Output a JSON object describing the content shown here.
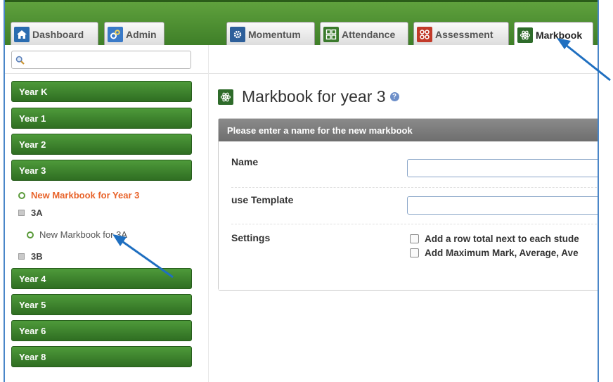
{
  "tabs": [
    {
      "label": "Dashboard",
      "icon": "home-icon",
      "color": "#2a6cb0"
    },
    {
      "label": "Admin",
      "icon": "gears-icon",
      "color": "#3a7ac8"
    },
    {
      "label": "Momentum",
      "icon": "gear-icon",
      "color": "#2d5f9a"
    },
    {
      "label": "Attendance",
      "icon": "attendance-icon",
      "color": "#3a7a2c"
    },
    {
      "label": "Assessment",
      "icon": "assessment-icon",
      "color": "#c23a2a"
    },
    {
      "label": "Markbook",
      "icon": "atom-icon",
      "color": "#2e6b2a"
    }
  ],
  "sidebar": {
    "years": [
      "Year K",
      "Year 1",
      "Year 2",
      "Year 3",
      "Year 4",
      "Year 5",
      "Year 6",
      "Year 8"
    ],
    "tree": {
      "new_markbook_year": "New Markbook for Year 3",
      "class_3a": "3A",
      "new_markbook_3a": "New Markbook for 3A",
      "class_3b": "3B"
    }
  },
  "main": {
    "title": "Markbook for year 3",
    "panel_header": "Please enter a name for the new markbook",
    "fields": {
      "name_label": "Name",
      "template_label": "use Template",
      "settings_label": "Settings",
      "setting_1": "Add a row total next to each stude",
      "setting_2": "Add Maximum Mark, Average, Ave"
    }
  },
  "colors": {
    "accent_green": "#3d7d27",
    "highlight_orange": "#e8632a",
    "arrow_blue": "#1f6fc0"
  }
}
